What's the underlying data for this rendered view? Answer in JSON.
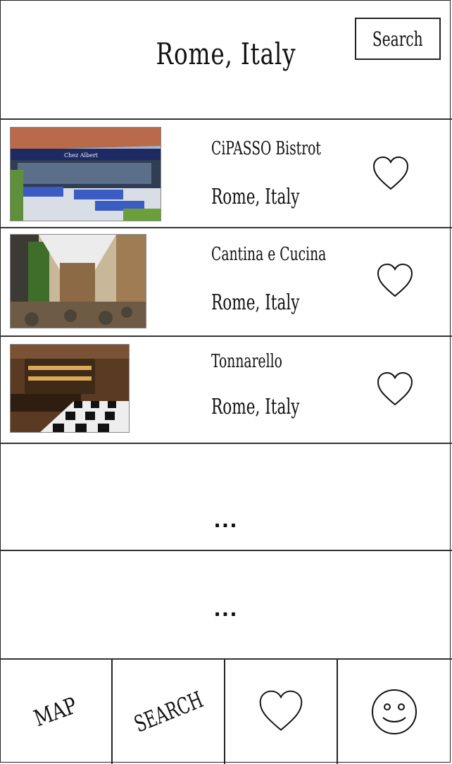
{
  "header": {
    "title": "Rome, Italy",
    "search_label": "Search"
  },
  "restaurants": [
    {
      "name": "CiPASSO Bistrot",
      "location": "Rome, Italy",
      "image_label": "Chez Albert"
    },
    {
      "name": "Cantina e Cucina",
      "location": "Rome, Italy"
    },
    {
      "name": "Tonnarello",
      "location": "Rome, Italy"
    }
  ],
  "placeholders": [
    "...",
    "..."
  ],
  "tabbar": {
    "map_label": "MAP",
    "search_label": "SEARCH",
    "favorites_icon": "heart-icon",
    "profile_icon": "smiley-face-icon"
  },
  "colors": {
    "accent": "#2b4f9e",
    "ink": "#111111"
  }
}
